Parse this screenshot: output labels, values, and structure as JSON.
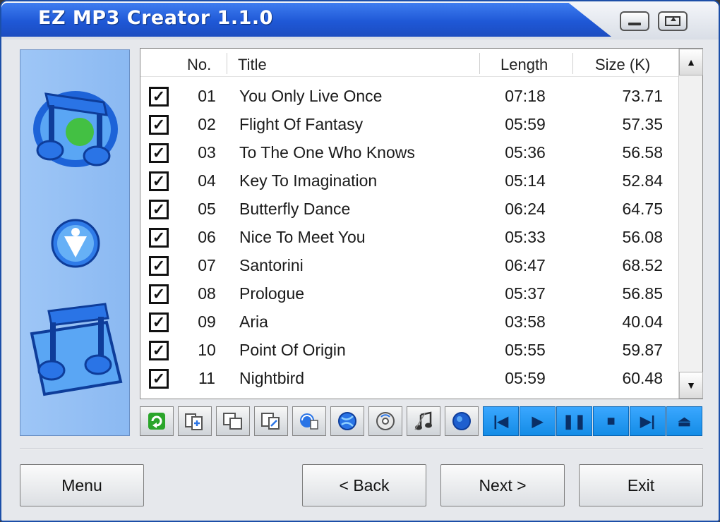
{
  "window": {
    "title": "EZ MP3 Creator 1.1.0",
    "accent_color": "#1f58d6"
  },
  "titlebar_buttons": [
    "minimize-icon",
    "maximize-icon"
  ],
  "track_list": {
    "columns": {
      "no": "No.",
      "title": "Title",
      "length": "Length",
      "size": "Size (K)"
    },
    "rows": [
      {
        "checked": true,
        "no": "01",
        "title": "You Only Live Once",
        "length": "07:18",
        "size": "73.71"
      },
      {
        "checked": true,
        "no": "02",
        "title": "Flight Of Fantasy",
        "length": "05:59",
        "size": "57.35"
      },
      {
        "checked": true,
        "no": "03",
        "title": "To The One Who Knows",
        "length": "05:36",
        "size": "56.58"
      },
      {
        "checked": true,
        "no": "04",
        "title": "Key To Imagination",
        "length": "05:14",
        "size": "52.84"
      },
      {
        "checked": true,
        "no": "05",
        "title": "Butterfly Dance",
        "length": "06:24",
        "size": "64.75"
      },
      {
        "checked": true,
        "no": "06",
        "title": "Nice To Meet You",
        "length": "05:33",
        "size": "56.08"
      },
      {
        "checked": true,
        "no": "07",
        "title": "Santorini",
        "length": "06:47",
        "size": "68.52"
      },
      {
        "checked": true,
        "no": "08",
        "title": "Prologue",
        "length": "05:37",
        "size": "56.85"
      },
      {
        "checked": true,
        "no": "09",
        "title": "Aria",
        "length": "03:58",
        "size": "40.04"
      },
      {
        "checked": true,
        "no": "10",
        "title": "Point Of Origin",
        "length": "05:55",
        "size": "59.87"
      },
      {
        "checked": true,
        "no": "11",
        "title": "Nightbird",
        "length": "05:59",
        "size": "60.48"
      }
    ],
    "check_glyph": "✓"
  },
  "toolbar": {
    "tools": [
      "refresh-icon",
      "add-files-icon",
      "copy-icon",
      "edit-icon",
      "convert-icon",
      "web-icon",
      "cd-icon",
      "music-note-icon",
      "record-icon"
    ],
    "media": [
      {
        "icon": "previous-icon",
        "glyph": "|◀"
      },
      {
        "icon": "play-icon",
        "glyph": "▶"
      },
      {
        "icon": "pause-icon",
        "glyph": "❚❚"
      },
      {
        "icon": "stop-icon",
        "glyph": "■"
      },
      {
        "icon": "next-icon",
        "glyph": "▶|"
      },
      {
        "icon": "eject-icon",
        "glyph": "⏏"
      }
    ]
  },
  "buttons": {
    "menu": "Menu",
    "back": "< Back",
    "next": "Next >",
    "exit": "Exit"
  },
  "sidebar_icons": [
    "music-disc-icon",
    "download-arrow-icon",
    "music-folder-icon"
  ]
}
